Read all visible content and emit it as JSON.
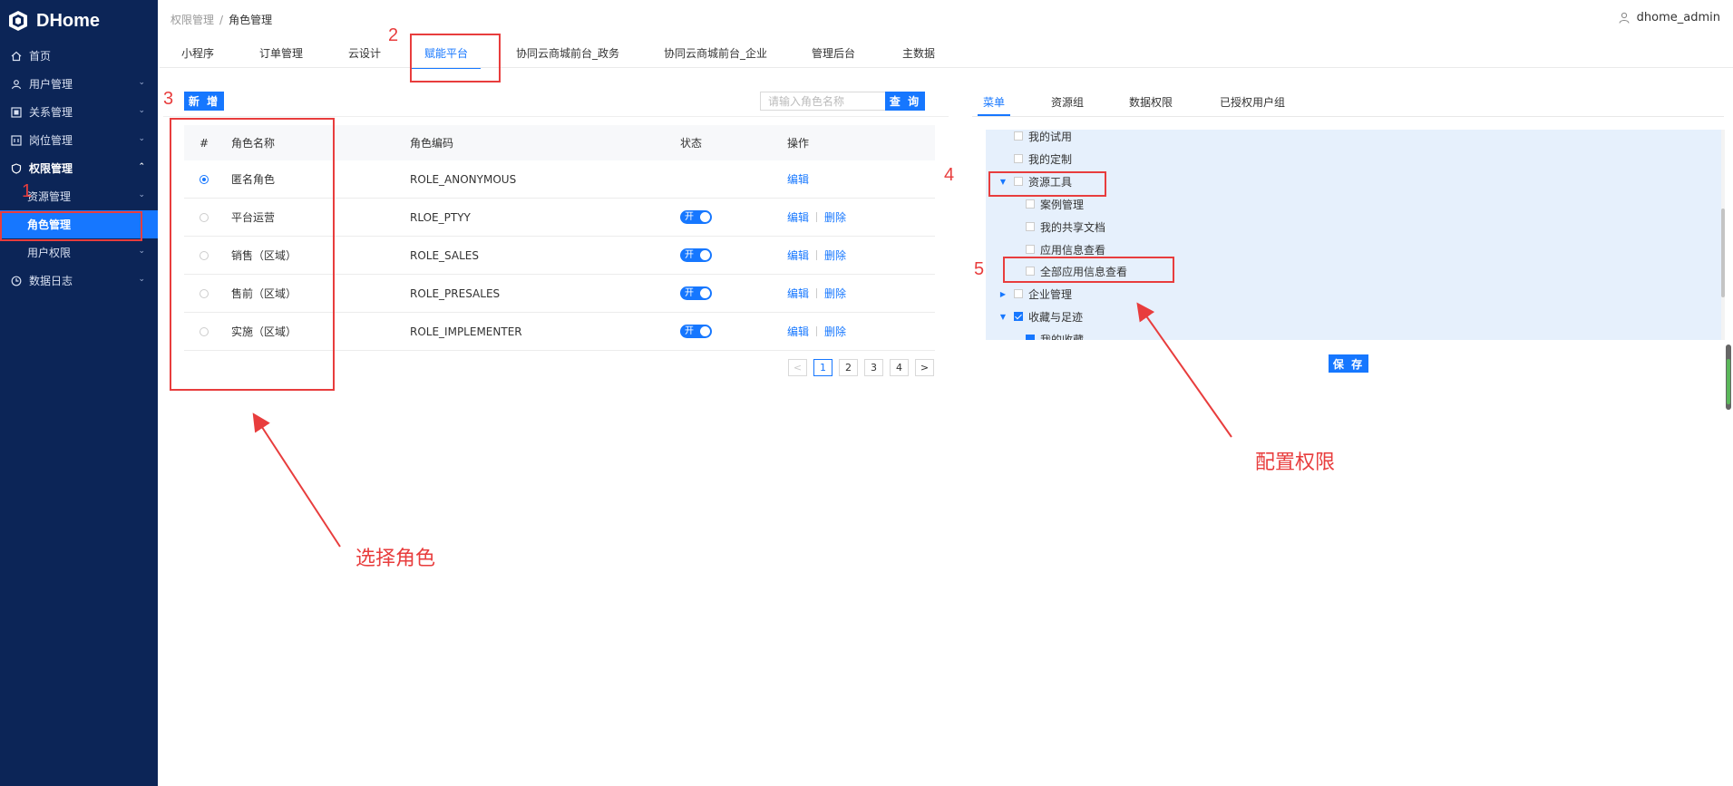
{
  "app": {
    "name": "DHome"
  },
  "sidebar": {
    "items": [
      {
        "label": "首页",
        "icon": "home-icon"
      },
      {
        "label": "用户管理",
        "icon": "user-icon"
      },
      {
        "label": "关系管理",
        "icon": "relation-icon"
      },
      {
        "label": "岗位管理",
        "icon": "post-icon"
      },
      {
        "label": "权限管理",
        "icon": "shield-icon",
        "open": true
      },
      {
        "label": "资源管理",
        "sub": true
      },
      {
        "label": "角色管理",
        "sub": true,
        "active": true
      },
      {
        "label": "用户权限",
        "sub": true
      },
      {
        "label": "数据日志",
        "icon": "log-icon"
      }
    ]
  },
  "header": {
    "breadcrumb": [
      "权限管理",
      "角色管理"
    ],
    "breadcrumb_sep": "/",
    "user": "dhome_admin"
  },
  "tabs": [
    {
      "label": "小程序"
    },
    {
      "label": "订单管理"
    },
    {
      "label": "云设计"
    },
    {
      "label": "赋能平台",
      "active": true
    },
    {
      "label": "协同云商城前台_政务"
    },
    {
      "label": "协同云商城前台_企业"
    },
    {
      "label": "管理后台"
    },
    {
      "label": "主数据"
    }
  ],
  "roles": {
    "add_label": "新 增",
    "search_placeholder": "请输入角色名称",
    "search_value": "",
    "search_label": "查 询",
    "columns": [
      "#",
      "角色名称",
      "角色编码",
      "状态",
      "操作"
    ],
    "rows": [
      {
        "selected": true,
        "name": "匿名角色",
        "code": "ROLE_ANONYMOUS",
        "status": "",
        "actions": [
          "编辑"
        ]
      },
      {
        "selected": false,
        "name": "平台运营",
        "code": "RLOE_PTYY",
        "status": "开",
        "actions": [
          "编辑",
          "删除"
        ]
      },
      {
        "selected": false,
        "name": "销售（区域）",
        "code": "ROLE_SALES",
        "status": "开",
        "actions": [
          "编辑",
          "删除"
        ]
      },
      {
        "selected": false,
        "name": "售前（区域）",
        "code": "ROLE_PRESALES",
        "status": "开",
        "actions": [
          "编辑",
          "删除"
        ]
      },
      {
        "selected": false,
        "name": "实施（区域）",
        "code": "ROLE_IMPLEMENTER",
        "status": "开",
        "actions": [
          "编辑",
          "删除"
        ]
      }
    ],
    "pagination": {
      "prev": "<",
      "pages": [
        "1",
        "2",
        "3",
        "4"
      ],
      "current": "1",
      "next": ">"
    }
  },
  "permissions": {
    "tabs": [
      {
        "label": "菜单",
        "active": true
      },
      {
        "label": "资源组"
      },
      {
        "label": "数据权限"
      },
      {
        "label": "已授权用户组"
      }
    ],
    "tree": [
      {
        "label": "我的试用",
        "level": 1,
        "checked": false
      },
      {
        "label": "我的定制",
        "level": 1,
        "checked": false
      },
      {
        "label": "资源工具",
        "level": 0,
        "expanded": true,
        "checked": false
      },
      {
        "label": "案例管理",
        "level": 2,
        "checked": false
      },
      {
        "label": "我的共享文档",
        "level": 2,
        "checked": false
      },
      {
        "label": "应用信息查看",
        "level": 2,
        "checked": false
      },
      {
        "label": "全部应用信息查看",
        "level": 2,
        "checked": false
      },
      {
        "label": "企业管理",
        "level": 0,
        "expanded": false,
        "checked": false
      },
      {
        "label": "收藏与足迹",
        "level": 0,
        "expanded": true,
        "checked": true
      },
      {
        "label": "我的收藏",
        "level": 2,
        "checked": true
      }
    ],
    "save_label": "保 存"
  },
  "annotations": {
    "numbers": [
      "1",
      "2",
      "3",
      "4",
      "5"
    ],
    "select_role": "选择角色",
    "config_perm": "配置权限",
    "color": "#e83d3d"
  },
  "colors": {
    "sidebar_bg": "#0c2557",
    "accent": "#1677ff",
    "tree_bg": "#e6f0fc"
  }
}
